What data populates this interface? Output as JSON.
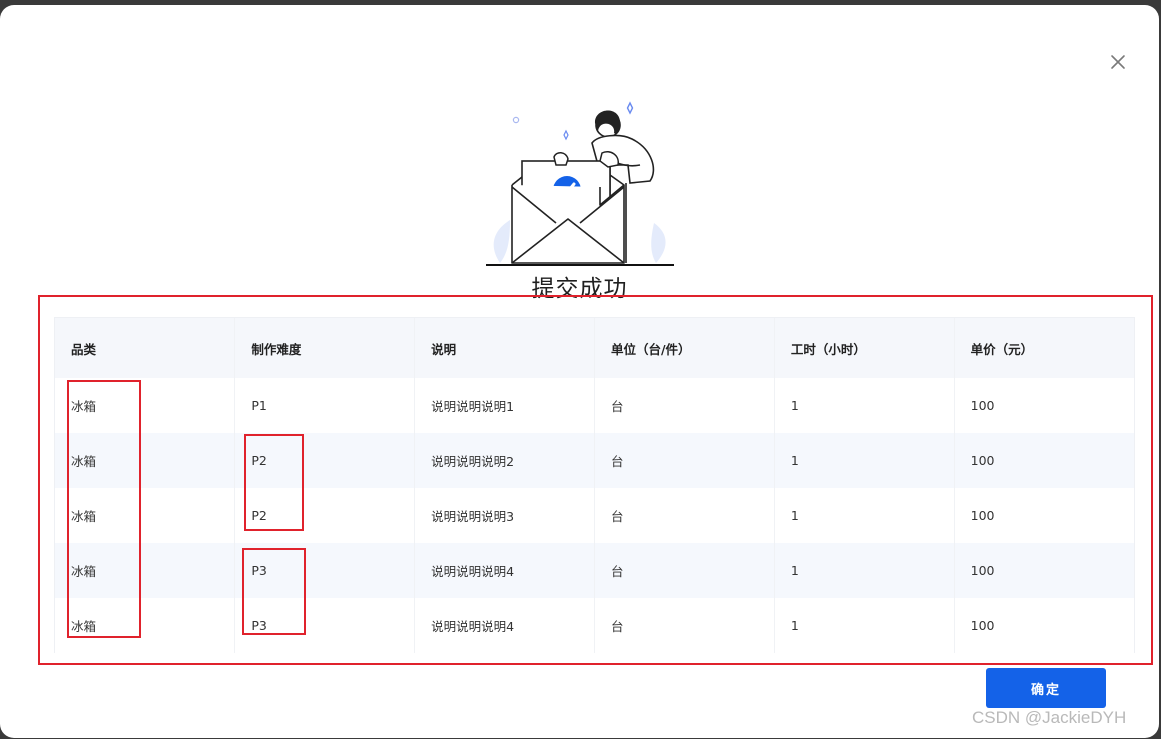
{
  "dialog": {
    "title": "提交成功",
    "confirm_label": "确定"
  },
  "table": {
    "columns": [
      "品类",
      "制作难度",
      "说明",
      "单位（台/件）",
      "工时（小时）",
      "单价（元）"
    ],
    "rows": [
      [
        "冰箱",
        "P1",
        "说明说明说明1",
        "台",
        "1",
        "100"
      ],
      [
        "冰箱",
        "P2",
        "说明说明说明2",
        "台",
        "1",
        "100"
      ],
      [
        "冰箱",
        "P2",
        "说明说明说明3",
        "台",
        "1",
        "100"
      ],
      [
        "冰箱",
        "P3",
        "说明说明说明4",
        "台",
        "1",
        "100"
      ],
      [
        "冰箱",
        "P3",
        "说明说明说明4",
        "台",
        "1",
        "100"
      ]
    ]
  },
  "watermark": "CSDN @JackieDYH",
  "colors": {
    "primary": "#1462e8",
    "annotation_red": "#e0222c"
  },
  "icons": [
    "close-icon",
    "success-envelope-illustration",
    "check-icon"
  ]
}
